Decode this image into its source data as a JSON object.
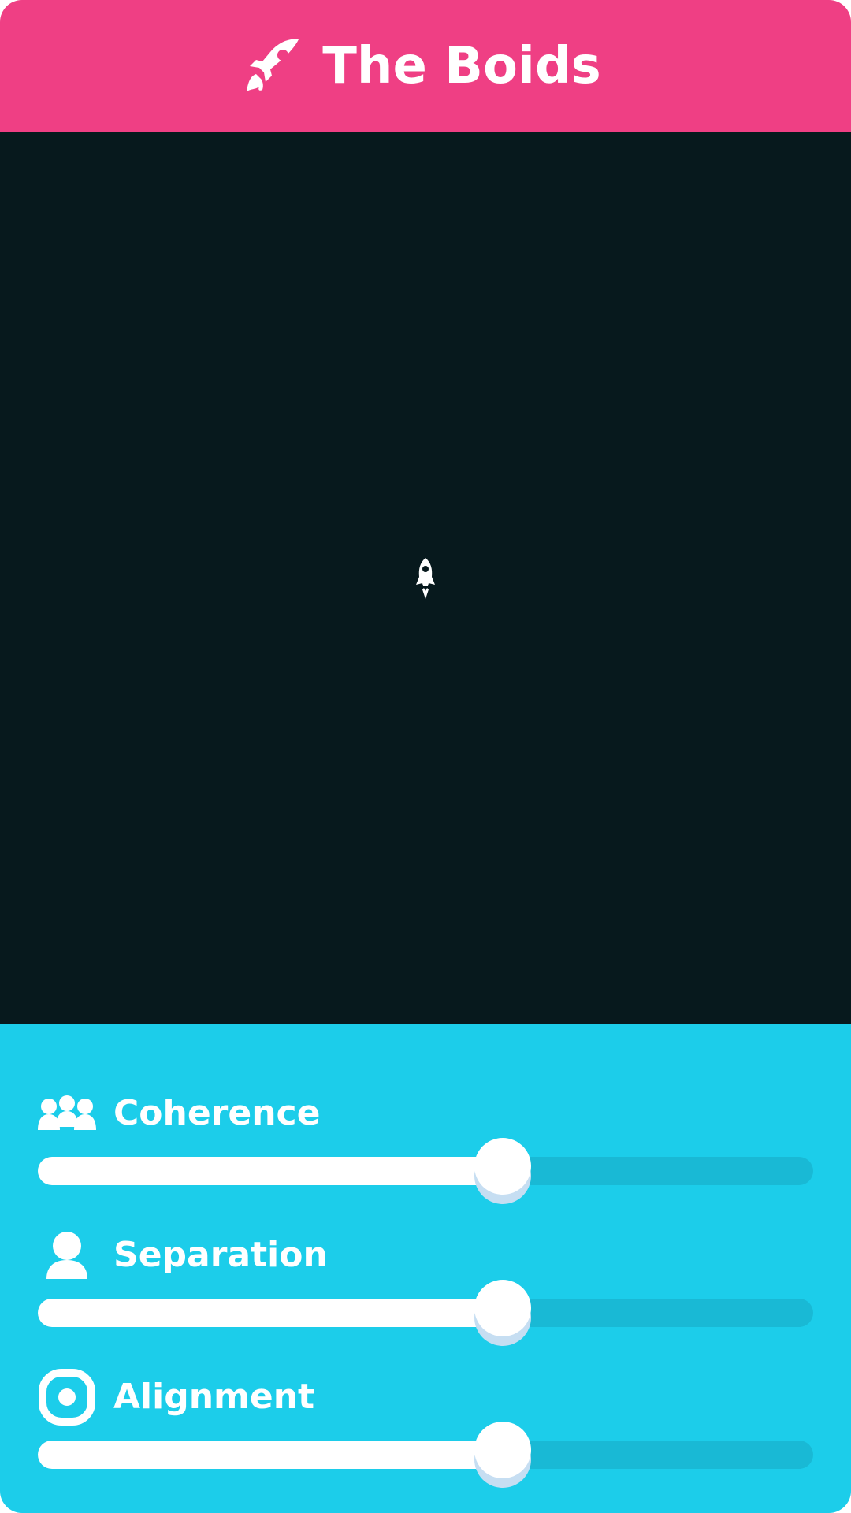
{
  "app": {
    "title": "The Boids",
    "header_icon": "rocket-icon",
    "colors": {
      "header": "#ef3f84",
      "canvas": "#07191d",
      "controls": "#1ccdea",
      "track": "#19b9d5",
      "fill": "#ffffff",
      "thumb_shadow": "#c6def2"
    }
  },
  "canvas": {
    "boid_icon": "rocket-icon"
  },
  "controls": [
    {
      "id": "coherence",
      "label": "Coherence",
      "icon": "group-icon",
      "value": 0.6
    },
    {
      "id": "separation",
      "label": "Separation",
      "icon": "person-icon",
      "value": 0.6
    },
    {
      "id": "alignment",
      "label": "Alignment",
      "icon": "target-icon",
      "value": 0.6
    }
  ]
}
